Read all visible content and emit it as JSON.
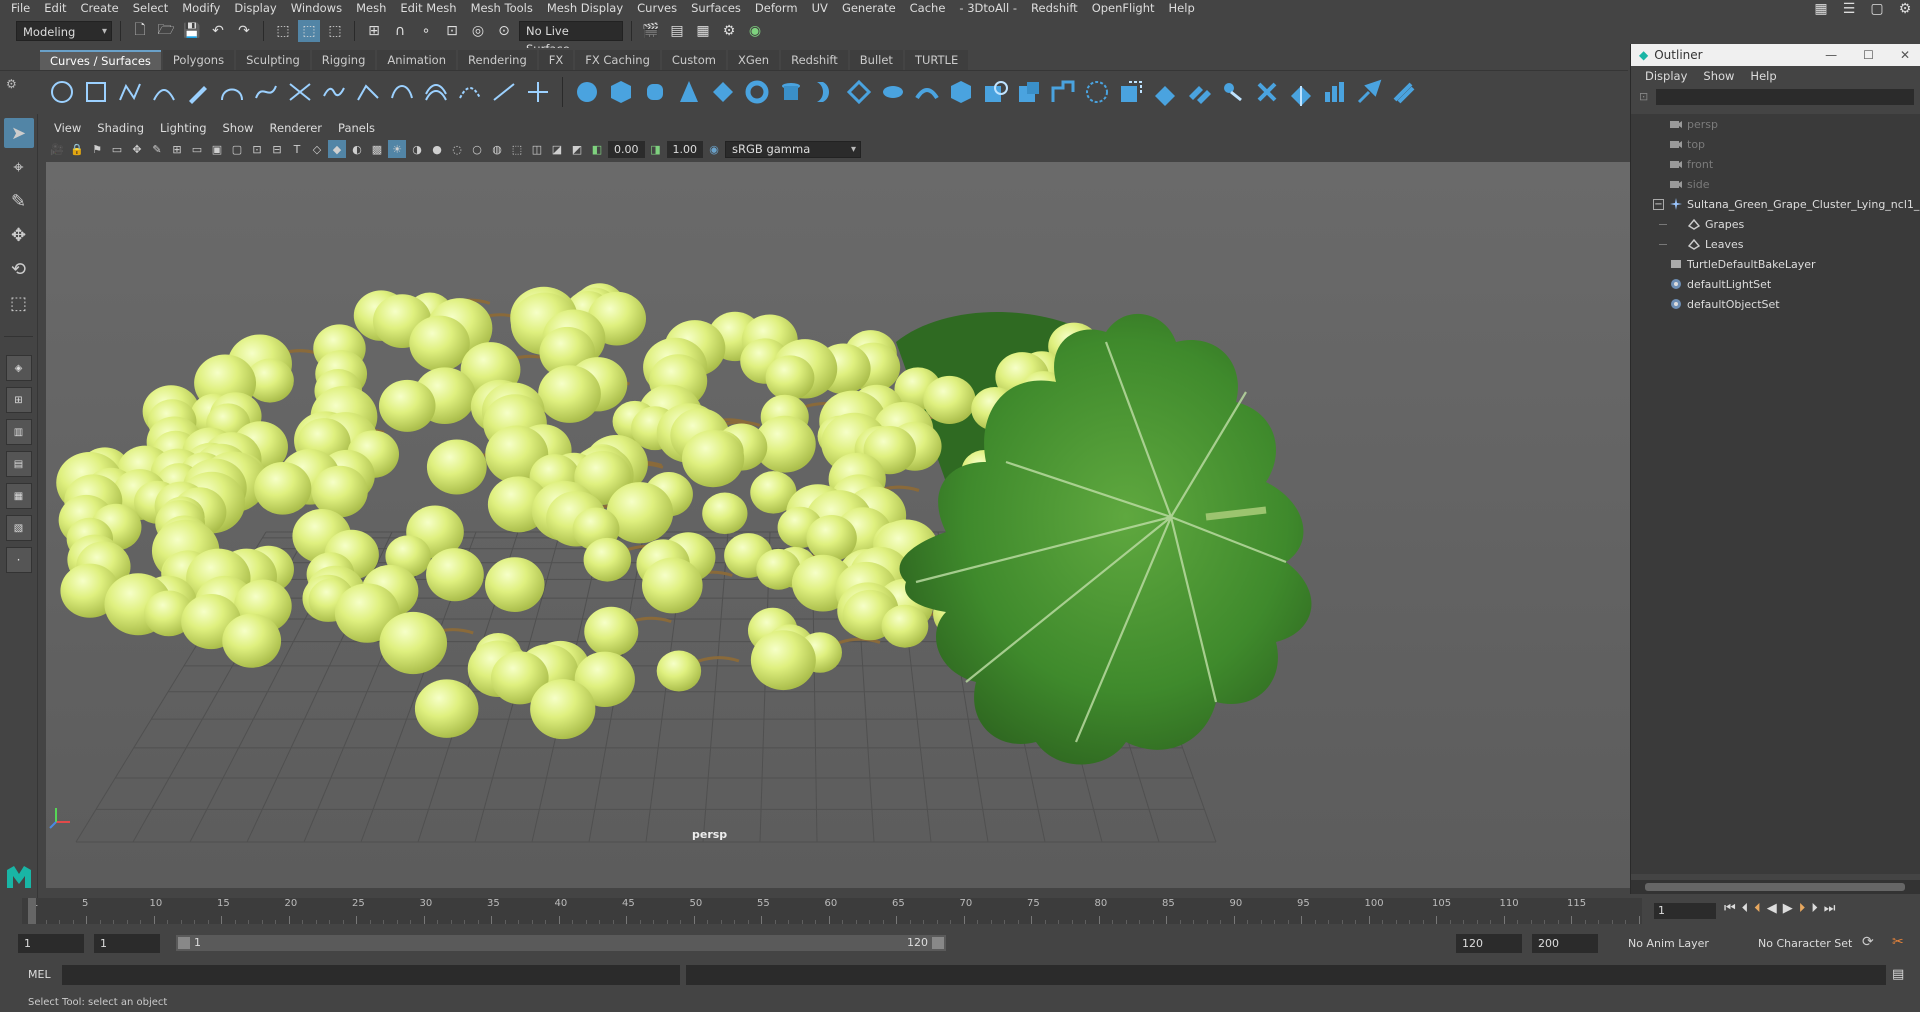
{
  "menubar": {
    "items": [
      "File",
      "Edit",
      "Create",
      "Select",
      "Modify",
      "Display",
      "Windows",
      "Mesh",
      "Edit Mesh",
      "Mesh Tools",
      "Mesh Display",
      "Curves",
      "Surfaces",
      "Deform",
      "UV",
      "Generate",
      "Cache",
      "- 3DtoAll -",
      "Redshift",
      "OpenFlight",
      "Help"
    ]
  },
  "statusline": {
    "menu_set": "Modeling",
    "live_surface": "No Live Surface"
  },
  "shelf": {
    "tabs": [
      "Curves / Surfaces",
      "Polygons",
      "Sculpting",
      "Rigging",
      "Animation",
      "Rendering",
      "FX",
      "FX Caching",
      "Custom",
      "XGen",
      "Redshift",
      "Bullet",
      "TURTLE"
    ],
    "active_tab": "Curves / Surfaces"
  },
  "panel": {
    "menus": [
      "View",
      "Shading",
      "Lighting",
      "Show",
      "Renderer",
      "Panels"
    ],
    "exposure": "0.00",
    "gamma": "1.00",
    "color_space": "sRGB gamma",
    "camera_label": "persp"
  },
  "outliner": {
    "title": "Outliner",
    "menus": [
      "Display",
      "Show",
      "Help"
    ],
    "rows": [
      {
        "label": "persp",
        "indent": 1,
        "dim": true,
        "icon": "camera-icon"
      },
      {
        "label": "top",
        "indent": 1,
        "dim": true,
        "icon": "camera-icon"
      },
      {
        "label": "front",
        "indent": 1,
        "dim": true,
        "icon": "camera-icon"
      },
      {
        "label": "side",
        "indent": 1,
        "dim": true,
        "icon": "camera-icon"
      },
      {
        "label": "Sultana_Green_Grape_Cluster_Lying_ncl1_1",
        "indent": 1,
        "dim": false,
        "icon": "group-icon",
        "expander": "−"
      },
      {
        "label": "Grapes",
        "indent": 2,
        "dim": false,
        "icon": "mesh-icon"
      },
      {
        "label": "Leaves",
        "indent": 2,
        "dim": false,
        "icon": "mesh-icon"
      },
      {
        "label": "TurtleDefaultBakeLayer",
        "indent": 1,
        "dim": false,
        "icon": "node-icon"
      },
      {
        "label": "defaultLightSet",
        "indent": 1,
        "dim": false,
        "icon": "set-icon"
      },
      {
        "label": "defaultObjectSet",
        "indent": 1,
        "dim": false,
        "icon": "set-icon"
      }
    ]
  },
  "timeslider": {
    "ticks": [
      "1",
      "5",
      "10",
      "15",
      "20",
      "25",
      "30",
      "35",
      "40",
      "45",
      "50",
      "55",
      "60",
      "65",
      "70",
      "75",
      "80",
      "85",
      "90",
      "95",
      "100",
      "105",
      "110",
      "115"
    ],
    "current_frame": "1"
  },
  "rangeslider": {
    "start": "1",
    "range_start": "1",
    "range_start_label": "1",
    "range_end_label": "120",
    "range_end": "120",
    "end": "200",
    "anim_layer": "No Anim Layer",
    "character_set": "No Character Set"
  },
  "cmdline": {
    "label": "MEL"
  },
  "helpline": {
    "text": "Select Tool: select an object"
  },
  "colors": {
    "accent": "#5285a6",
    "grape": "#d6ec7a",
    "leaf": "#3f7f2d"
  }
}
